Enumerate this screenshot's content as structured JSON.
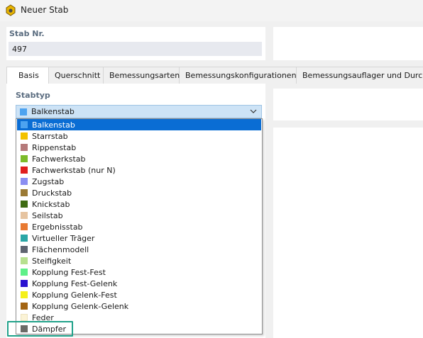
{
  "window": {
    "title": "Neuer Stab"
  },
  "stab": {
    "label": "Stab Nr.",
    "value": "497"
  },
  "tabs": [
    {
      "label": "Basis"
    },
    {
      "label": "Querschnitt"
    },
    {
      "label": "Bemessungsarten"
    },
    {
      "label": "Bemessungskonfigurationen"
    },
    {
      "label": "Bemessungsauflager und Durchbi"
    }
  ],
  "stabtyp": {
    "label": "Stabtyp",
    "selected": {
      "label": "Balkenstab",
      "color": "#4da3f0"
    },
    "options": [
      {
        "label": "Balkenstab",
        "color": "#4da3f0"
      },
      {
        "label": "Starrstab",
        "color": "#f2c200"
      },
      {
        "label": "Rippenstab",
        "color": "#b57a7a"
      },
      {
        "label": "Fachwerkstab",
        "color": "#7dbb2a"
      },
      {
        "label": "Fachwerkstab (nur N)",
        "color": "#e01e1e"
      },
      {
        "label": "Zugstab",
        "color": "#8b8ef2"
      },
      {
        "label": "Druckstab",
        "color": "#9b7a35"
      },
      {
        "label": "Knickstab",
        "color": "#3e6b12"
      },
      {
        "label": "Seilstab",
        "color": "#e6c4a1"
      },
      {
        "label": "Ergebnisstab",
        "color": "#e87a33"
      },
      {
        "label": "Virtueller Träger",
        "color": "#2ba6a6"
      },
      {
        "label": "Flächenmodell",
        "color": "#5e6470"
      },
      {
        "label": "Steifigkeit",
        "color": "#b7e08f"
      },
      {
        "label": "Kopplung Fest-Fest",
        "color": "#5ef089"
      },
      {
        "label": "Kopplung Fest-Gelenk",
        "color": "#2a12d0"
      },
      {
        "label": "Kopplung Gelenk-Fest",
        "color": "#f5f01a"
      },
      {
        "label": "Kopplung Gelenk-Gelenk",
        "color": "#a36412"
      },
      {
        "label": "Feder",
        "color": "#fbf3d6"
      },
      {
        "label": "Dämpfer",
        "color": "#6b6b66"
      }
    ]
  }
}
